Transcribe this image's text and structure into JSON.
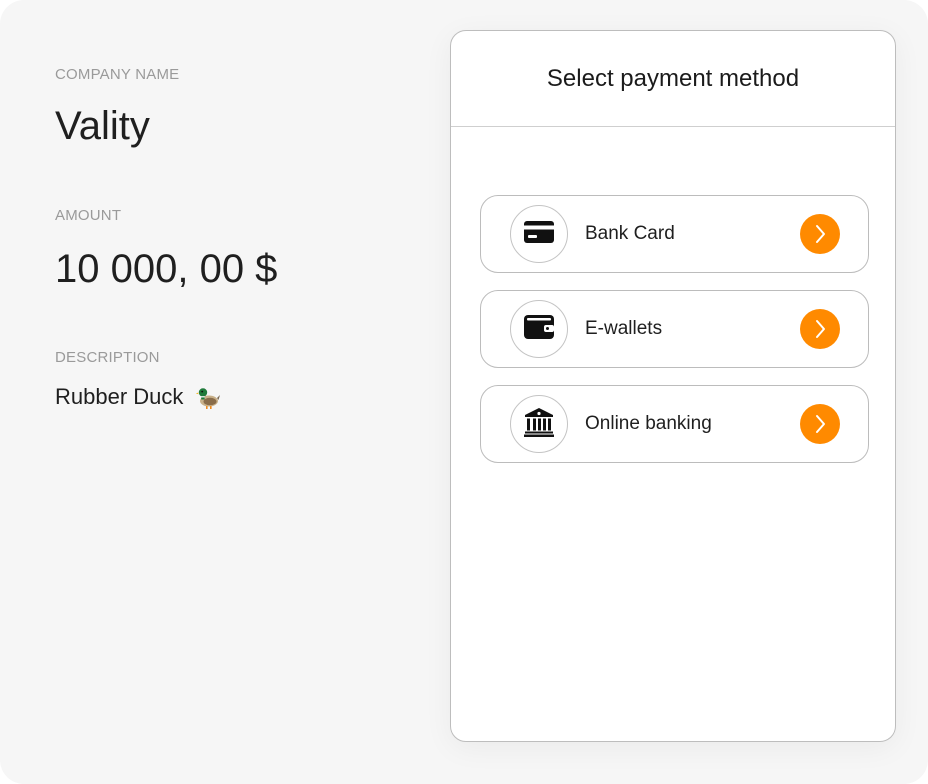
{
  "merchant": {
    "company_label": "COMPANY NAME",
    "company_name": "Vality",
    "amount_label": "AMOUNT",
    "amount_value": "10 000, 00 $",
    "description_label": "DESCRIPTION",
    "description_value": "Rubber Duck",
    "description_emoji_icon": "duck-icon"
  },
  "payment": {
    "title": "Select payment method",
    "methods": [
      {
        "label": "Bank Card",
        "icon": "credit-card-icon"
      },
      {
        "label": "E-wallets",
        "icon": "wallet-icon"
      },
      {
        "label": "Online banking",
        "icon": "bank-building-icon"
      }
    ],
    "arrow_icon": "chevron-right-icon"
  },
  "colors": {
    "accent": "#ff8a00",
    "background": "#f6f6f6",
    "card": "#ffffff",
    "label_gray": "#9a9a9a",
    "text": "#1f1f1f"
  }
}
